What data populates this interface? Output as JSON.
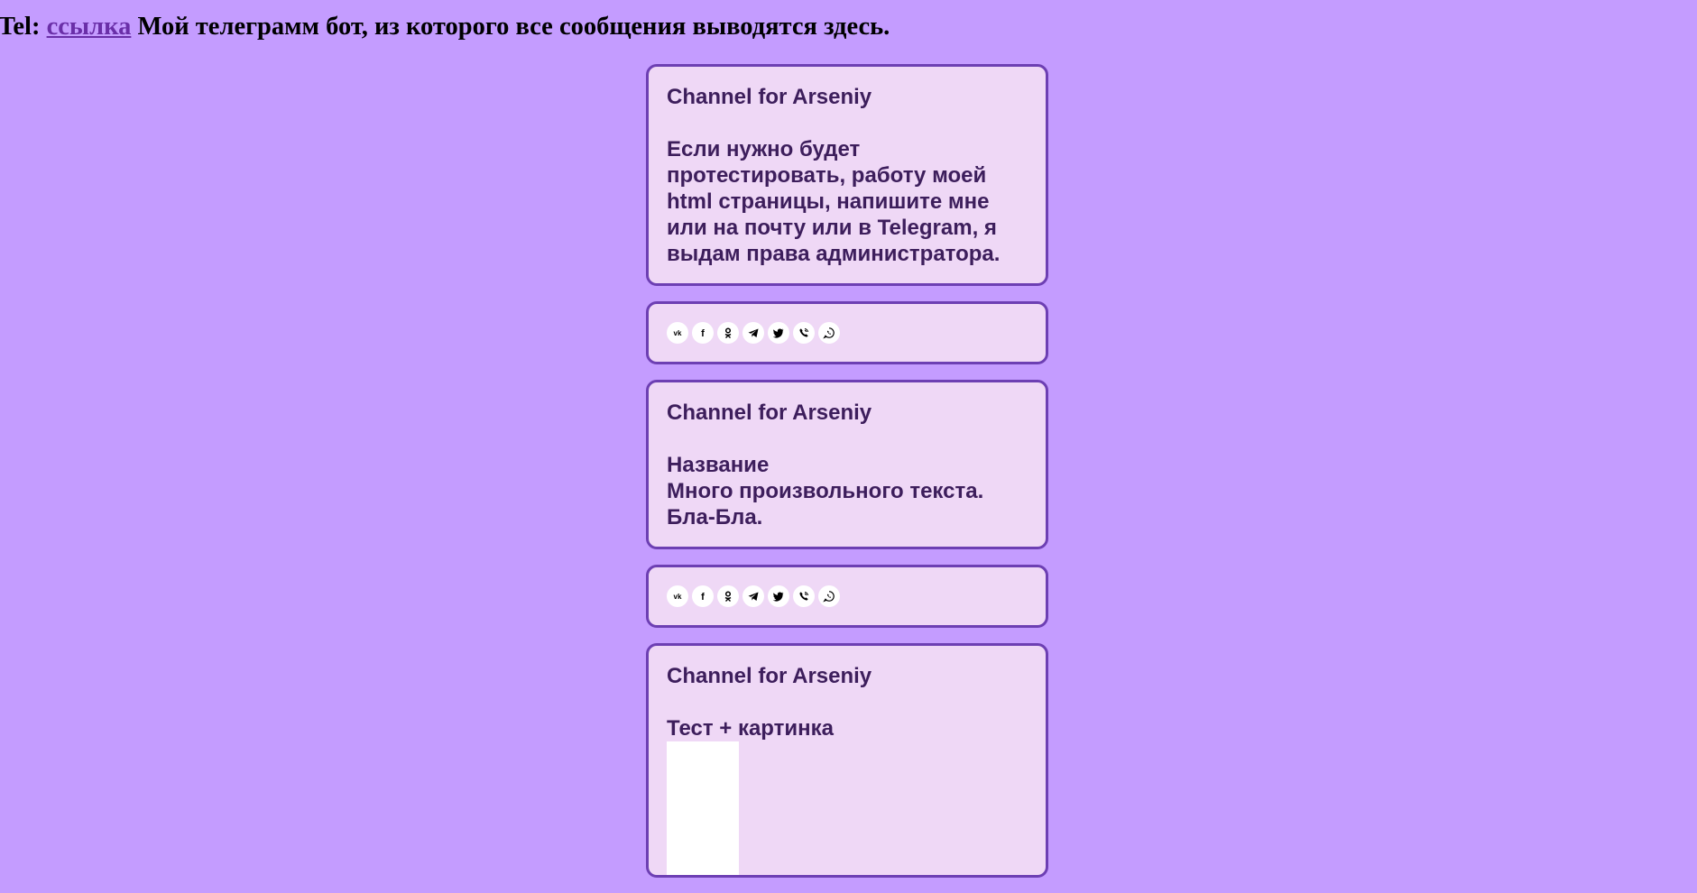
{
  "header": {
    "prefix": "Tel:",
    "link_label": "ссылка",
    "suffix": "Мой телеграмм бот, из которого все сообщения выводятся здесь."
  },
  "posts": [
    {
      "channel": "Channel for Arseniy",
      "text": "Если нужно будет протестировать, работу моей html страницы, напишите мне или на почту или в Telegram, я выдам права администратора."
    },
    {
      "channel": "Channel for Arseniy",
      "text": "Название\nМного произвольного текста.\nБла-Бла."
    },
    {
      "channel": "Channel for Arseniy",
      "text": "Тест + картинка"
    }
  ],
  "share_icons": [
    "vk-icon",
    "facebook-icon",
    "odnoklassniki-icon",
    "telegram-icon",
    "twitter-icon",
    "viber-icon",
    "whatsapp-icon"
  ],
  "colors": {
    "page_background": "#c49cff",
    "card_background": "#efd8f6",
    "card_border": "#6d3fb3",
    "card_text": "#3d1e5c",
    "link": "#6a2fa8"
  }
}
